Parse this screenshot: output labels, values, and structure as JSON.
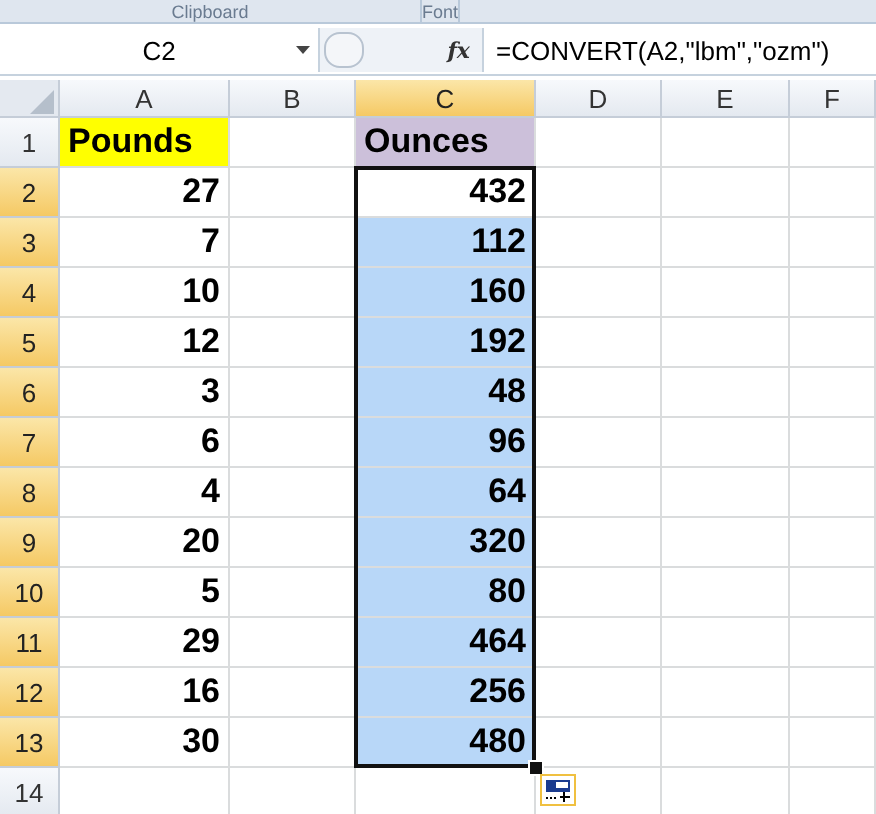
{
  "ribbon_groups": [
    {
      "label": "Clipboard"
    },
    {
      "label": "Font"
    }
  ],
  "formula_bar": {
    "name_box": "C2",
    "fx": "fx",
    "formula": "=CONVERT(A2,\"lbm\",\"ozm\")"
  },
  "columns": [
    {
      "label": "A",
      "selected": false
    },
    {
      "label": "B",
      "selected": false
    },
    {
      "label": "C",
      "selected": true
    },
    {
      "label": "D",
      "selected": false
    },
    {
      "label": "E",
      "selected": false
    },
    {
      "label": "F",
      "selected": false
    }
  ],
  "rows": [
    {
      "header": "1",
      "selected": false,
      "pounds": {
        "kind": "label",
        "text": "Pounds",
        "color": "#ffff00"
      },
      "ounces": {
        "kind": "label",
        "text": "Ounces",
        "color": "#ccc0da"
      }
    },
    {
      "header": "2",
      "selected": true,
      "pounds": {
        "kind": "number",
        "text": "27"
      },
      "ounces": {
        "kind": "number",
        "text": "432",
        "active": true
      }
    },
    {
      "header": "3",
      "selected": true,
      "pounds": {
        "kind": "number",
        "text": "7"
      },
      "ounces": {
        "kind": "number",
        "text": "112",
        "selected": true
      }
    },
    {
      "header": "4",
      "selected": true,
      "pounds": {
        "kind": "number",
        "text": "10"
      },
      "ounces": {
        "kind": "number",
        "text": "160",
        "selected": true
      }
    },
    {
      "header": "5",
      "selected": true,
      "pounds": {
        "kind": "number",
        "text": "12"
      },
      "ounces": {
        "kind": "number",
        "text": "192",
        "selected": true
      }
    },
    {
      "header": "6",
      "selected": true,
      "pounds": {
        "kind": "number",
        "text": "3"
      },
      "ounces": {
        "kind": "number",
        "text": "48",
        "selected": true
      }
    },
    {
      "header": "7",
      "selected": true,
      "pounds": {
        "kind": "number",
        "text": "6"
      },
      "ounces": {
        "kind": "number",
        "text": "96",
        "selected": true
      }
    },
    {
      "header": "8",
      "selected": true,
      "pounds": {
        "kind": "number",
        "text": "4"
      },
      "ounces": {
        "kind": "number",
        "text": "64",
        "selected": true
      }
    },
    {
      "header": "9",
      "selected": true,
      "pounds": {
        "kind": "number",
        "text": "20"
      },
      "ounces": {
        "kind": "number",
        "text": "320",
        "selected": true
      }
    },
    {
      "header": "10",
      "selected": true,
      "pounds": {
        "kind": "number",
        "text": "5"
      },
      "ounces": {
        "kind": "number",
        "text": "80",
        "selected": true
      }
    },
    {
      "header": "11",
      "selected": true,
      "pounds": {
        "kind": "number",
        "text": "29"
      },
      "ounces": {
        "kind": "number",
        "text": "464",
        "selected": true
      }
    },
    {
      "header": "12",
      "selected": true,
      "pounds": {
        "kind": "number",
        "text": "16"
      },
      "ounces": {
        "kind": "number",
        "text": "256",
        "selected": true
      }
    },
    {
      "header": "13",
      "selected": true,
      "pounds": {
        "kind": "number",
        "text": "30"
      },
      "ounces": {
        "kind": "number",
        "text": "480",
        "selected": true
      }
    },
    {
      "header": "14",
      "selected": false
    }
  ]
}
